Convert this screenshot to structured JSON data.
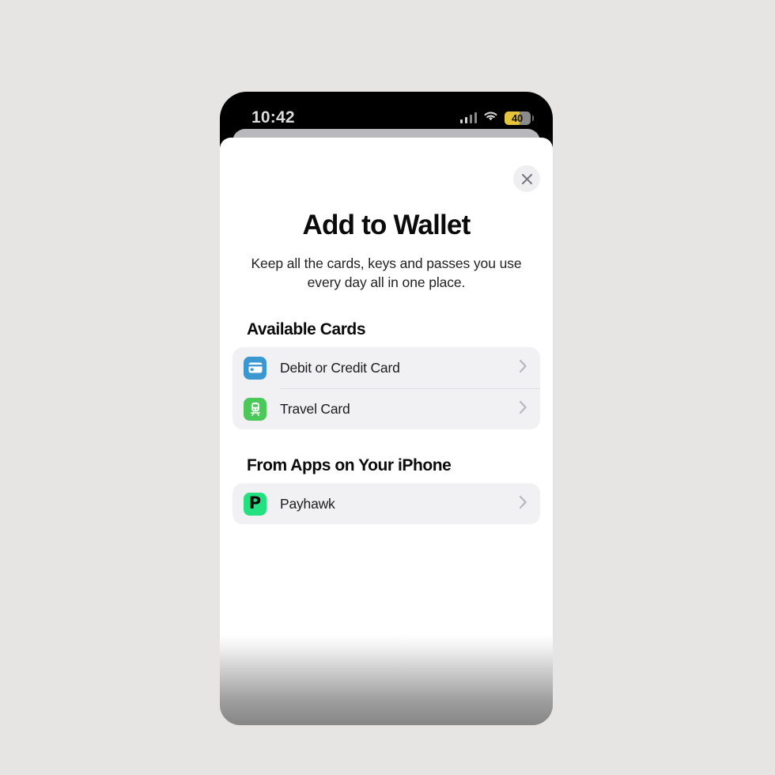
{
  "page": {
    "background_color": "#e6e5e3"
  },
  "status_bar": {
    "time": "10:42",
    "cellular_icon": "cellular-bars-icon",
    "wifi_icon": "wifi-icon",
    "battery": {
      "level_text": "40",
      "level_percent": 40,
      "color": "#e5c43b",
      "low_power_mode": true
    }
  },
  "sheet": {
    "close_button": {
      "icon": "close-icon",
      "label": "Close"
    },
    "title": "Add to Wallet",
    "subtitle": "Keep all the cards, keys and passes you use every day all in one place.",
    "sections": [
      {
        "id": "available-cards",
        "header": "Available Cards",
        "rows": [
          {
            "id": "debit-or-credit-card",
            "label": "Debit or Credit Card",
            "icon": "credit-card-icon",
            "icon_color": "#3b97cf",
            "chevron": "chevron-right-icon"
          },
          {
            "id": "travel-card",
            "label": "Travel Card",
            "icon": "train-icon",
            "icon_color": "#4cc85a",
            "chevron": "chevron-right-icon"
          }
        ]
      },
      {
        "id": "from-apps",
        "header": "From Apps on Your iPhone",
        "rows": [
          {
            "id": "payhawk",
            "label": "Payhawk",
            "icon": "payhawk-app-icon",
            "icon_letter": "P",
            "icon_color": "#23e17f",
            "chevron": "chevron-right-icon"
          }
        ]
      }
    ]
  }
}
